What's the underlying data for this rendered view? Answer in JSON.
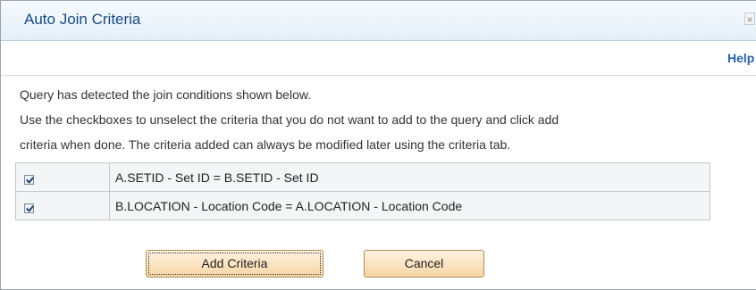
{
  "dialog": {
    "title": "Auto Join Criteria",
    "close_glyph": "×",
    "help_label": "Help"
  },
  "instructions": {
    "line1": "Query has detected the join conditions shown below.",
    "line2": "Use the checkboxes to unselect the criteria that you do not want to add to the query and click add",
    "line3": "criteria when done. The criteria added can always be modified later using the criteria tab."
  },
  "criteria": [
    {
      "checked": true,
      "text": "A.SETID - Set ID = B.SETID - Set ID"
    },
    {
      "checked": true,
      "text": "B.LOCATION - Location Code = A.LOCATION - Location Code"
    }
  ],
  "buttons": {
    "add_label": "Add Criteria",
    "cancel_label": "Cancel"
  },
  "colors": {
    "title": "#1b4a83",
    "link": "#2a63a8",
    "button_fill": "#f7d6a5"
  },
  "icons": {
    "close": "close-icon",
    "checkbox": "checkbox-checked-icon"
  }
}
